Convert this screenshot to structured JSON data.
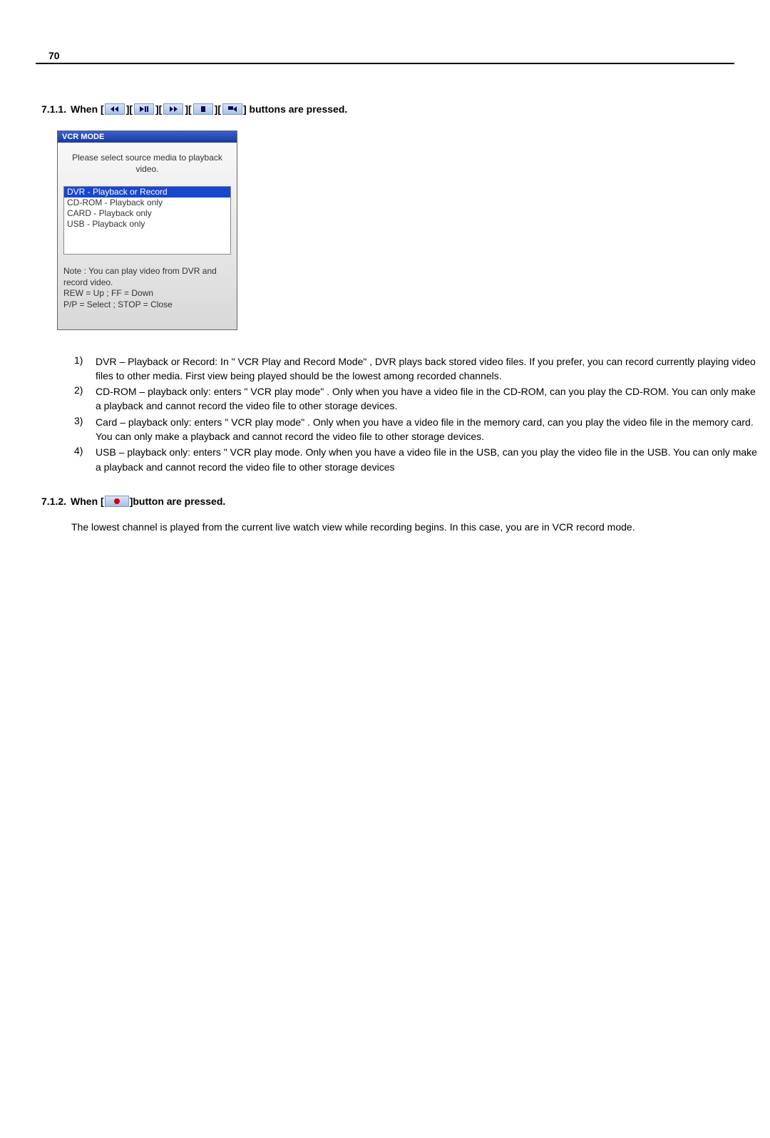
{
  "page_number": "70",
  "section711": {
    "number": "7.1.1.",
    "prefix": "When [",
    "mid_separator": "][",
    "suffix": "] buttons are pressed."
  },
  "dialog": {
    "title": "VCR MODE",
    "prompt_line1": "Please select source media to playback",
    "prompt_line2": "video.",
    "items": [
      "DVR - Playback or Record",
      "CD-ROM - Playback only",
      "CARD - Playback only",
      "USB - Playback only"
    ],
    "note_line1": "Note : You can play video from DVR and",
    "note_line2": "record video.",
    "note_line3": "REW = Up ; FF = Down",
    "note_line4": "P/P = Select ; STOP = Close"
  },
  "list": [
    {
      "idx": "1)",
      "text": "DVR – Playback or Record: In \" VCR Play and Record Mode\" , DVR plays back stored video files. If you prefer, you can record currently playing video files to other media. First view being played should be the lowest among recorded channels."
    },
    {
      "idx": "2)",
      "text": "CD-ROM – playback only: enters \" VCR play mode\" . Only when you have a video file in the CD-ROM, can you play the CD-ROM. You can only make a playback and cannot record the video file to other storage devices."
    },
    {
      "idx": "3)",
      "text": "Card – playback only: enters \" VCR play mode\" . Only when you have a video file in the memory card, can you play the video file in the memory card. You can only make a playback and cannot record the video file to other storage devices."
    },
    {
      "idx": "4)",
      "text": "USB – playback only: enters \" VCR play mode. Only when you have a video file in the USB, can you play the video file in the USB. You can only make a playback and cannot record the video file to other storage devices"
    }
  ],
  "section712": {
    "number": "7.1.2.",
    "prefix": "When [",
    "suffix": "]button are pressed.",
    "body": "The lowest channel is played from the current live watch view while recording begins. In this case, you are in VCR record mode."
  }
}
